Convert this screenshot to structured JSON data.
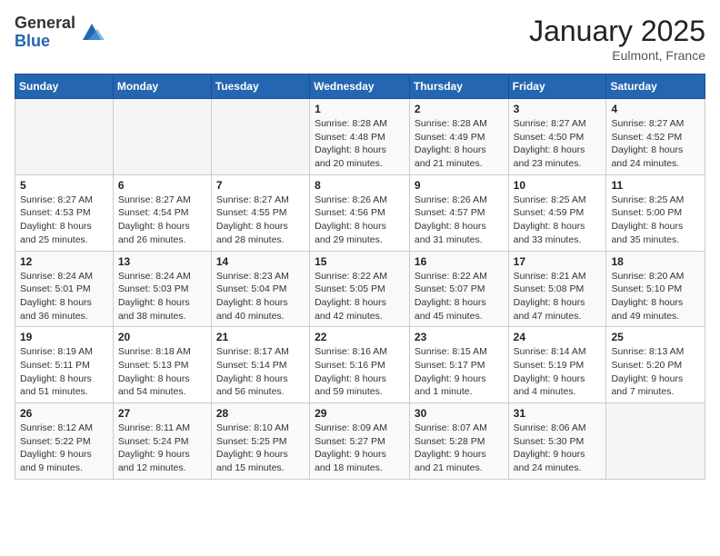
{
  "logo": {
    "general": "General",
    "blue": "Blue"
  },
  "header": {
    "month": "January 2025",
    "location": "Eulmont, France"
  },
  "weekdays": [
    "Sunday",
    "Monday",
    "Tuesday",
    "Wednesday",
    "Thursday",
    "Friday",
    "Saturday"
  ],
  "weeks": [
    [
      {
        "day": "",
        "sunrise": "",
        "sunset": "",
        "daylight": ""
      },
      {
        "day": "",
        "sunrise": "",
        "sunset": "",
        "daylight": ""
      },
      {
        "day": "",
        "sunrise": "",
        "sunset": "",
        "daylight": ""
      },
      {
        "day": "1",
        "sunrise": "Sunrise: 8:28 AM",
        "sunset": "Sunset: 4:48 PM",
        "daylight": "Daylight: 8 hours and 20 minutes."
      },
      {
        "day": "2",
        "sunrise": "Sunrise: 8:28 AM",
        "sunset": "Sunset: 4:49 PM",
        "daylight": "Daylight: 8 hours and 21 minutes."
      },
      {
        "day": "3",
        "sunrise": "Sunrise: 8:27 AM",
        "sunset": "Sunset: 4:50 PM",
        "daylight": "Daylight: 8 hours and 23 minutes."
      },
      {
        "day": "4",
        "sunrise": "Sunrise: 8:27 AM",
        "sunset": "Sunset: 4:52 PM",
        "daylight": "Daylight: 8 hours and 24 minutes."
      }
    ],
    [
      {
        "day": "5",
        "sunrise": "Sunrise: 8:27 AM",
        "sunset": "Sunset: 4:53 PM",
        "daylight": "Daylight: 8 hours and 25 minutes."
      },
      {
        "day": "6",
        "sunrise": "Sunrise: 8:27 AM",
        "sunset": "Sunset: 4:54 PM",
        "daylight": "Daylight: 8 hours and 26 minutes."
      },
      {
        "day": "7",
        "sunrise": "Sunrise: 8:27 AM",
        "sunset": "Sunset: 4:55 PM",
        "daylight": "Daylight: 8 hours and 28 minutes."
      },
      {
        "day": "8",
        "sunrise": "Sunrise: 8:26 AM",
        "sunset": "Sunset: 4:56 PM",
        "daylight": "Daylight: 8 hours and 29 minutes."
      },
      {
        "day": "9",
        "sunrise": "Sunrise: 8:26 AM",
        "sunset": "Sunset: 4:57 PM",
        "daylight": "Daylight: 8 hours and 31 minutes."
      },
      {
        "day": "10",
        "sunrise": "Sunrise: 8:25 AM",
        "sunset": "Sunset: 4:59 PM",
        "daylight": "Daylight: 8 hours and 33 minutes."
      },
      {
        "day": "11",
        "sunrise": "Sunrise: 8:25 AM",
        "sunset": "Sunset: 5:00 PM",
        "daylight": "Daylight: 8 hours and 35 minutes."
      }
    ],
    [
      {
        "day": "12",
        "sunrise": "Sunrise: 8:24 AM",
        "sunset": "Sunset: 5:01 PM",
        "daylight": "Daylight: 8 hours and 36 minutes."
      },
      {
        "day": "13",
        "sunrise": "Sunrise: 8:24 AM",
        "sunset": "Sunset: 5:03 PM",
        "daylight": "Daylight: 8 hours and 38 minutes."
      },
      {
        "day": "14",
        "sunrise": "Sunrise: 8:23 AM",
        "sunset": "Sunset: 5:04 PM",
        "daylight": "Daylight: 8 hours and 40 minutes."
      },
      {
        "day": "15",
        "sunrise": "Sunrise: 8:22 AM",
        "sunset": "Sunset: 5:05 PM",
        "daylight": "Daylight: 8 hours and 42 minutes."
      },
      {
        "day": "16",
        "sunrise": "Sunrise: 8:22 AM",
        "sunset": "Sunset: 5:07 PM",
        "daylight": "Daylight: 8 hours and 45 minutes."
      },
      {
        "day": "17",
        "sunrise": "Sunrise: 8:21 AM",
        "sunset": "Sunset: 5:08 PM",
        "daylight": "Daylight: 8 hours and 47 minutes."
      },
      {
        "day": "18",
        "sunrise": "Sunrise: 8:20 AM",
        "sunset": "Sunset: 5:10 PM",
        "daylight": "Daylight: 8 hours and 49 minutes."
      }
    ],
    [
      {
        "day": "19",
        "sunrise": "Sunrise: 8:19 AM",
        "sunset": "Sunset: 5:11 PM",
        "daylight": "Daylight: 8 hours and 51 minutes."
      },
      {
        "day": "20",
        "sunrise": "Sunrise: 8:18 AM",
        "sunset": "Sunset: 5:13 PM",
        "daylight": "Daylight: 8 hours and 54 minutes."
      },
      {
        "day": "21",
        "sunrise": "Sunrise: 8:17 AM",
        "sunset": "Sunset: 5:14 PM",
        "daylight": "Daylight: 8 hours and 56 minutes."
      },
      {
        "day": "22",
        "sunrise": "Sunrise: 8:16 AM",
        "sunset": "Sunset: 5:16 PM",
        "daylight": "Daylight: 8 hours and 59 minutes."
      },
      {
        "day": "23",
        "sunrise": "Sunrise: 8:15 AM",
        "sunset": "Sunset: 5:17 PM",
        "daylight": "Daylight: 9 hours and 1 minute."
      },
      {
        "day": "24",
        "sunrise": "Sunrise: 8:14 AM",
        "sunset": "Sunset: 5:19 PM",
        "daylight": "Daylight: 9 hours and 4 minutes."
      },
      {
        "day": "25",
        "sunrise": "Sunrise: 8:13 AM",
        "sunset": "Sunset: 5:20 PM",
        "daylight": "Daylight: 9 hours and 7 minutes."
      }
    ],
    [
      {
        "day": "26",
        "sunrise": "Sunrise: 8:12 AM",
        "sunset": "Sunset: 5:22 PM",
        "daylight": "Daylight: 9 hours and 9 minutes."
      },
      {
        "day": "27",
        "sunrise": "Sunrise: 8:11 AM",
        "sunset": "Sunset: 5:24 PM",
        "daylight": "Daylight: 9 hours and 12 minutes."
      },
      {
        "day": "28",
        "sunrise": "Sunrise: 8:10 AM",
        "sunset": "Sunset: 5:25 PM",
        "daylight": "Daylight: 9 hours and 15 minutes."
      },
      {
        "day": "29",
        "sunrise": "Sunrise: 8:09 AM",
        "sunset": "Sunset: 5:27 PM",
        "daylight": "Daylight: 9 hours and 18 minutes."
      },
      {
        "day": "30",
        "sunrise": "Sunrise: 8:07 AM",
        "sunset": "Sunset: 5:28 PM",
        "daylight": "Daylight: 9 hours and 21 minutes."
      },
      {
        "day": "31",
        "sunrise": "Sunrise: 8:06 AM",
        "sunset": "Sunset: 5:30 PM",
        "daylight": "Daylight: 9 hours and 24 minutes."
      },
      {
        "day": "",
        "sunrise": "",
        "sunset": "",
        "daylight": ""
      }
    ]
  ]
}
